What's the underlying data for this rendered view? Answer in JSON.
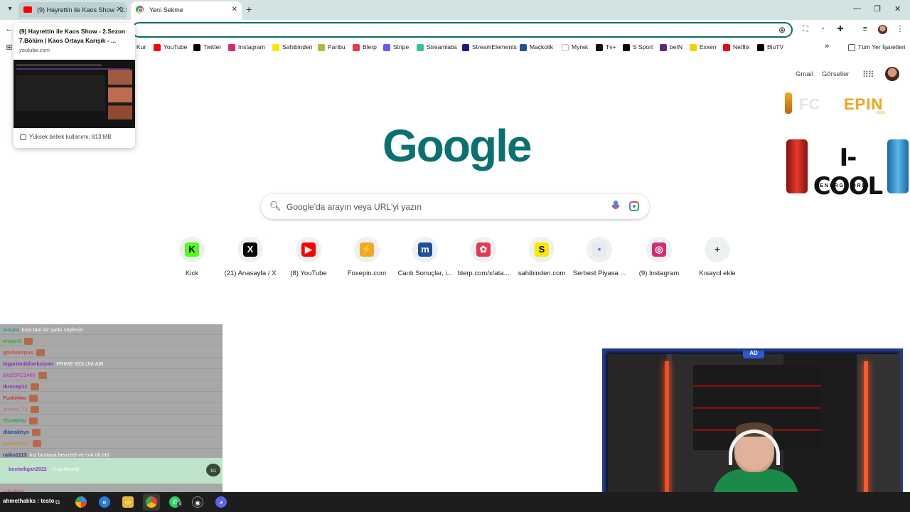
{
  "browser": {
    "tabs": [
      {
        "title": "(9) Hayrettin ile Kaos Show - 2.Sezon",
        "active": false
      },
      {
        "title": "Yeni Sekme",
        "active": true
      }
    ],
    "tab_close_glyph": "✕",
    "new_tab_glyph": "+",
    "window_controls": {
      "minimize": "—",
      "restore": "❐",
      "close": "✕"
    }
  },
  "bookmarks": [
    {
      "label": "Kur",
      "icon": "kur-icon",
      "color": "#ffffff"
    },
    {
      "label": "YouTube",
      "icon": "youtube-icon",
      "color": "#ff0000"
    },
    {
      "label": "Twitter",
      "icon": "x-icon",
      "color": "#000000"
    },
    {
      "label": "Instagram",
      "icon": "instagram-icon",
      "color": "#d62976"
    },
    {
      "label": "Sahibinden",
      "icon": "sahibinden-icon",
      "color": "#ffe800"
    },
    {
      "label": "Paribu",
      "icon": "paribu-icon",
      "color": "#a3c23a"
    },
    {
      "label": "Blerp",
      "icon": "blerp-icon",
      "color": "#e8384f"
    },
    {
      "label": "Stripe",
      "icon": "stripe-icon",
      "color": "#635bff"
    },
    {
      "label": "Streamlabs",
      "icon": "streamlabs-icon",
      "color": "#31c3a2"
    },
    {
      "label": "StreamElements",
      "icon": "streamelements-icon",
      "color": "#1a1a8a"
    },
    {
      "label": "Maçkolik",
      "icon": "mackolik-icon",
      "color": "#1f4fa0"
    },
    {
      "label": "Mynet",
      "icon": "mynet-icon",
      "color": "#ffffff"
    },
    {
      "label": "Tv+",
      "icon": "tvplus-icon",
      "color": "#111111"
    },
    {
      "label": "S Sport",
      "icon": "ssport-icon",
      "color": "#000000"
    },
    {
      "label": "beIN",
      "icon": "bein-icon",
      "color": "#5a2a82"
    },
    {
      "label": "Exxen",
      "icon": "exxen-icon",
      "color": "#f2d200"
    },
    {
      "label": "Netflix",
      "icon": "netflix-icon",
      "color": "#e50914"
    },
    {
      "label": "BluTV",
      "icon": "blutv-icon",
      "color": "#000000"
    }
  ],
  "bookmarks_overflow": "»",
  "all_bookmarks_label": "Tüm Yer İşaretleri",
  "hovercard": {
    "title": "(9) Hayrettin ile Kaos Show - 2.Sezon 7.Bölüm | Kaos Ortaya Karışık - ...",
    "domain": "youtube.com",
    "memory": "Yüksek bellek kullanımı: 813 MB"
  },
  "google": {
    "links": [
      "Gmail",
      "Görseller"
    ],
    "logo": "Google",
    "search_placeholder": "Google'da arayın veya URL'yi yazın",
    "shortcuts": [
      {
        "label": "Kick",
        "glyph": "K",
        "icon": "kick-icon",
        "color": "#53fc18",
        "fg": "#000000"
      },
      {
        "label": "(21) Anasayfa / X",
        "glyph": "X",
        "icon": "x-icon",
        "color": "#000000",
        "fg": "#ffffff"
      },
      {
        "label": "(8) YouTube",
        "glyph": "▶",
        "icon": "youtube-icon",
        "color": "#ff0000",
        "fg": "#ffffff"
      },
      {
        "label": "Foxepin.com",
        "glyph": "⚡",
        "icon": "foxepin-icon",
        "color": "#f5a623",
        "fg": "#ffffff"
      },
      {
        "label": "Canlı Sonuçlar, i...",
        "glyph": "m",
        "icon": "mackolik-icon",
        "color": "#1f4fa0",
        "fg": "#ffffff"
      },
      {
        "label": "blerp.com/x/ata...",
        "glyph": "✿",
        "icon": "blerp-icon",
        "color": "#e8384f",
        "fg": "#ffffff"
      },
      {
        "label": "sahibinden.com",
        "glyph": "S",
        "icon": "sahibinden-icon",
        "color": "#ffe800",
        "fg": "#000000"
      },
      {
        "label": "Serbest Piyasa ...",
        "glyph": "•",
        "icon": "serbest-piyasa-icon",
        "color": "#e8eaed",
        "fg": "#4285f4"
      },
      {
        "label": "(9) Instagram",
        "glyph": "◎",
        "icon": "instagram-icon",
        "color": "#d62976",
        "fg": "#ffffff"
      },
      {
        "label": "Kısayol ekle",
        "glyph": "+",
        "icon": "add-shortcut-icon",
        "color": "#eef1f1",
        "fg": "#333333"
      }
    ]
  },
  "ads": {
    "fc": "FC",
    "epin": "EPIN",
    "epin_sub": ".com",
    "icool": "I-COOL",
    "icool_sub": "ENERGY DRINK"
  },
  "chat": {
    "rows": [
      {
        "user": "ainura",
        "msg": "kısa tam bir şarkı söylesin",
        "color": "#2a9a9a"
      },
      {
        "user": "encari1",
        "msg": "",
        "color": "#33aa33"
      },
      {
        "user": "goshorspus",
        "msg": "",
        "color": "#cc4a4a"
      },
      {
        "user": "logaritmikfonksiyon",
        "msg": "PRIME BOLUM ABI",
        "color": "#8a2cc0"
      },
      {
        "user": "5A2CFC1465",
        "msg": "",
        "color": "#c040c0"
      },
      {
        "user": "tkrecep11",
        "msg": "",
        "color": "#8a2cc0"
      },
      {
        "user": "Furki44m",
        "msg": "",
        "color": "#d03a3a"
      },
      {
        "user": "mamir_71",
        "msg": "",
        "color": "#bb7a7a"
      },
      {
        "user": "TheRiFW",
        "msg": "",
        "color": "#33aa55"
      },
      {
        "user": "dilarakhys",
        "msg": "",
        "color": "#2a4aa0"
      },
      {
        "user": "semet3127",
        "msg": "",
        "color": "#cc8a3a"
      },
      {
        "user": "raiko1113",
        "msg": "kız bustaya benzedi ve cok tilt etti",
        "color": "#2a3a8a"
      }
    ],
    "highlight_user": "bestwikgan2022",
    "highlight_msg": "~3 ay desteği",
    "bottom_user": "adrabbit"
  },
  "taskbar": {
    "user_label": "ahmethakks : testo",
    "chrome_badge": "",
    "whatsapp_badge": "8"
  }
}
